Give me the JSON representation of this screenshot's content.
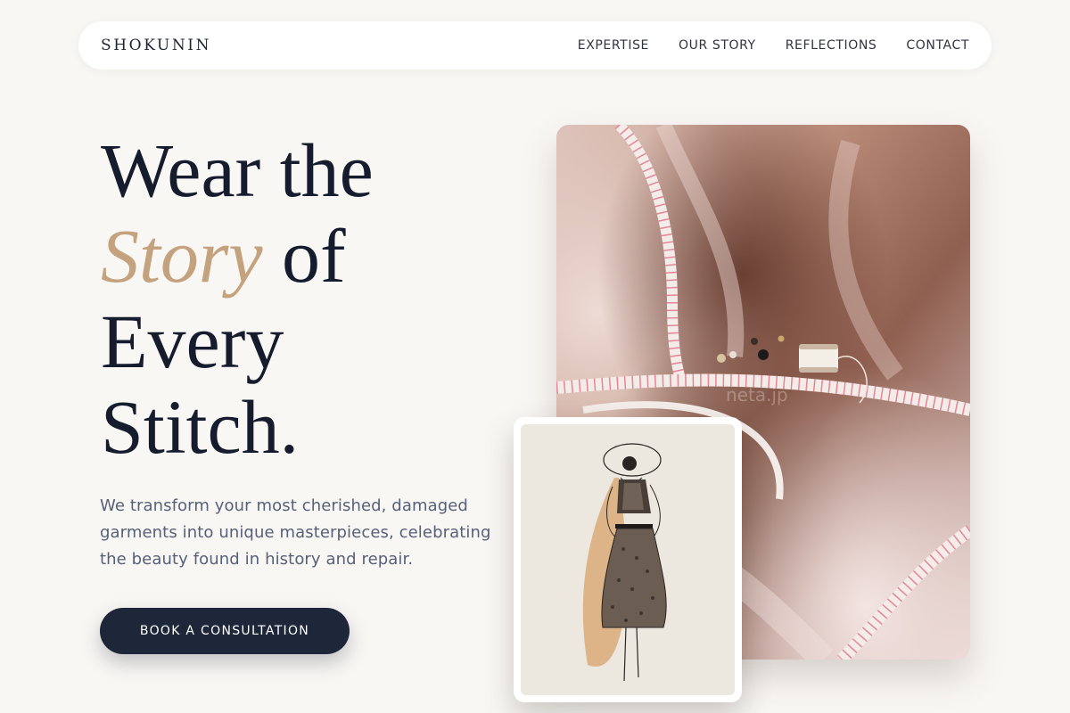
{
  "nav": {
    "brand": "SHOKUNIN",
    "links": [
      "EXPERTISE",
      "OUR STORY",
      "REFLECTIONS",
      "CONTACT"
    ]
  },
  "hero": {
    "headline": {
      "line1": "Wear the",
      "accent": "Story",
      "line2_rest": " of",
      "line3": "Every",
      "line4": "Stitch."
    },
    "lede": "We transform your most cherished, damaged garments into unique masterpieces, celebrating the beauty found in history and repair.",
    "cta_label": "BOOK A CONSULTATION"
  },
  "images": {
    "main_photo": "draped-silk-fabric-with-measuring-tape-and-thread-spool",
    "sketch": "vintage-fashion-illustration-woman-in-floral-dress",
    "watermark": "neta.jp"
  },
  "colors": {
    "background": "#f9f7f4",
    "navy": "#1e2639",
    "gold_accent": "#c4a27e",
    "body_text": "#55607a"
  }
}
